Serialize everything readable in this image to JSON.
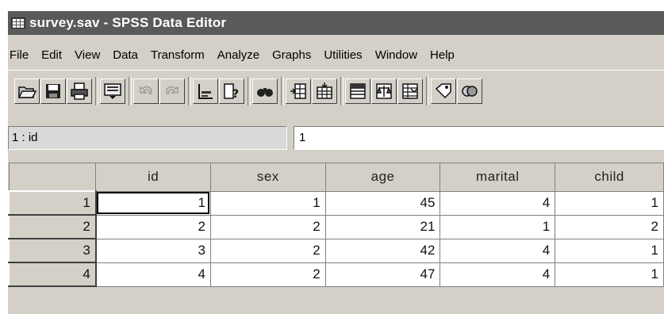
{
  "window": {
    "title": "survey.sav - SPSS Data Editor",
    "icon": "data-editor-icon"
  },
  "menu": [
    "File",
    "Edit",
    "View",
    "Data",
    "Transform",
    "Analyze",
    "Graphs",
    "Utilities",
    "Window",
    "Help"
  ],
  "toolbar": {
    "buttons": [
      "open-file-icon",
      "save-icon",
      "print-icon",
      "dialog-recall-icon",
      "undo-icon",
      "redo-icon",
      "goto-chart-icon",
      "goto-case-icon",
      "find-icon",
      "insert-case-icon",
      "insert-variable-icon",
      "split-file-icon",
      "weight-cases-icon",
      "select-cases-icon",
      "value-labels-icon",
      "use-sets-icon"
    ]
  },
  "cell_editor": {
    "reference": "1 : id",
    "value": "1"
  },
  "grid": {
    "columns": [
      "id",
      "sex",
      "age",
      "marital",
      "child"
    ],
    "rows": [
      {
        "num": "1",
        "cells": [
          "1",
          "1",
          "45",
          "4",
          "1"
        ]
      },
      {
        "num": "2",
        "cells": [
          "2",
          "2",
          "21",
          "1",
          "2"
        ]
      },
      {
        "num": "3",
        "cells": [
          "3",
          "2",
          "42",
          "4",
          "1"
        ]
      },
      {
        "num": "4",
        "cells": [
          "4",
          "2",
          "47",
          "4",
          "1"
        ]
      }
    ]
  }
}
